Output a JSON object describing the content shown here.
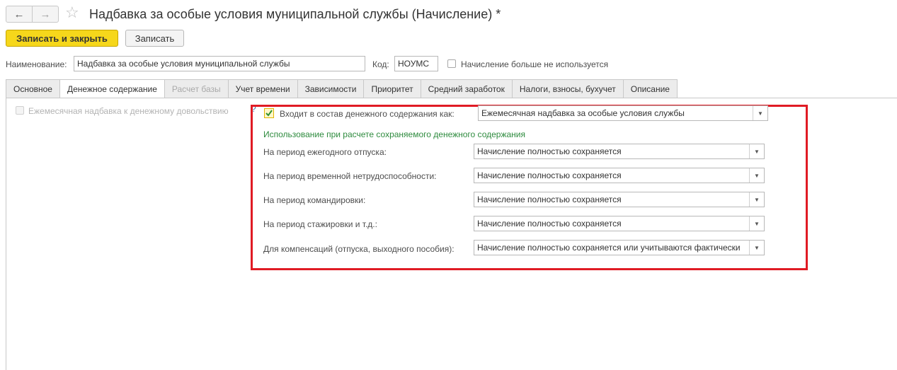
{
  "header": {
    "title": "Надбавка за особые условия муниципальной службы (Начисление) *",
    "back_icon": "←",
    "forward_icon": "→",
    "star_icon": "☆"
  },
  "toolbar": {
    "save_close_label": "Записать и закрыть",
    "save_label": "Записать"
  },
  "form": {
    "name_label": "Наименование:",
    "name_value": "Надбавка за особые условия муниципальной службы",
    "code_label": "Код:",
    "code_value": "НОУМС",
    "not_used_label": "Начисление больше не используется"
  },
  "tabs": [
    {
      "label": "Основное"
    },
    {
      "label": "Денежное содержание"
    },
    {
      "label": "Расчет базы"
    },
    {
      "label": "Учет времени"
    },
    {
      "label": "Зависимости"
    },
    {
      "label": "Приоритет"
    },
    {
      "label": "Средний заработок"
    },
    {
      "label": "Налоги, взносы, бухучет"
    },
    {
      "label": "Описание"
    }
  ],
  "money": {
    "monthly_bonus_label": "Ежемесячная надбавка к денежному довольствию",
    "question_mark": "?",
    "includes_label": "Входит в состав денежного содержания как:",
    "includes_value": "Ежемесячная надбавка за особые условия службы",
    "section_title": "Использование при расчете сохраняемого денежного содержания",
    "rows": [
      {
        "label": "На период ежегодного отпуска:",
        "value": "Начисление полностью сохраняется"
      },
      {
        "label": "На период временной нетрудоспособности:",
        "value": "Начисление полностью сохраняется"
      },
      {
        "label": "На период командировки:",
        "value": "Начисление полностью сохраняется"
      },
      {
        "label": "На период стажировки и т.д.:",
        "value": "Начисление полностью сохраняется"
      },
      {
        "label": "Для компенсаций (отпуска, выходного пособия):",
        "value": "Начисление полностью сохраняется или учитываются фактически"
      }
    ]
  },
  "colors": {
    "primary": "#f6d71b",
    "highlight": "#e01b24",
    "section": "#2e8b3e"
  }
}
